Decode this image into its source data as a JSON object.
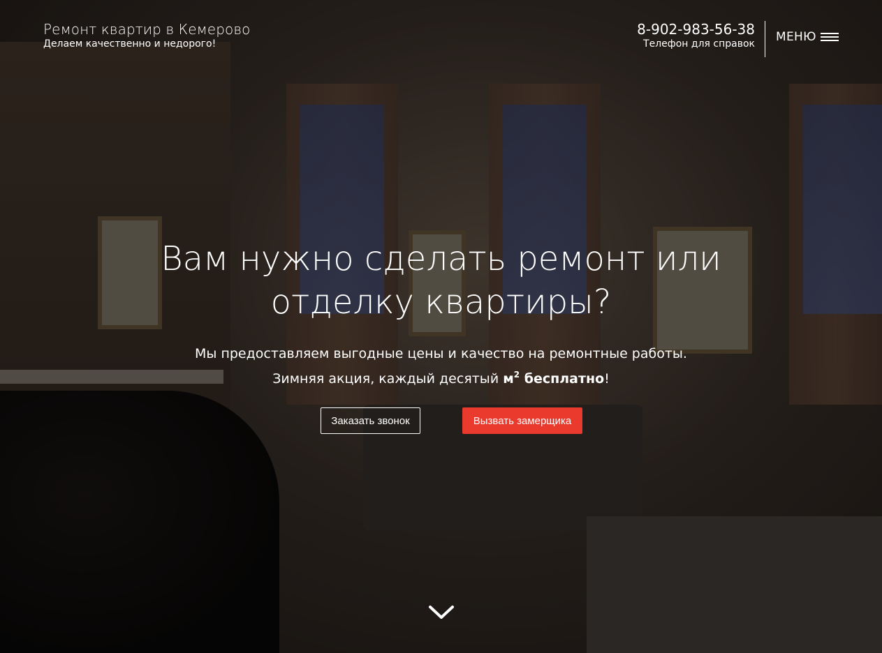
{
  "header": {
    "title": "Ремонт квартир в Кемерово",
    "subtitle": "Делаем качественно и недорого!",
    "phone": "8-902-983-56-38",
    "phone_label": "Телефон для справок",
    "menu_label": "МЕНЮ",
    "menu_icon": "hamburger-icon"
  },
  "hero": {
    "headline": "Вам нужно сделать ремонт или отделку квартиры?",
    "lead_line1": "Мы предоставляем выгодные цены и качество на ремонтные работы.",
    "lead_line2_prefix": "Зимняя акция, каждый десятый ",
    "lead_line2_bold_unit": "м",
    "lead_line2_sup": "2",
    "lead_line2_bold_rest": " бесплатно",
    "lead_line2_suffix": "!",
    "cta_call_label": "Заказать звонок",
    "cta_measure_label": "Вызвать замерщика",
    "scroll_icon": "chevron-down-icon"
  },
  "colors": {
    "accent": "#ea3a2e",
    "text": "#ffffff"
  }
}
